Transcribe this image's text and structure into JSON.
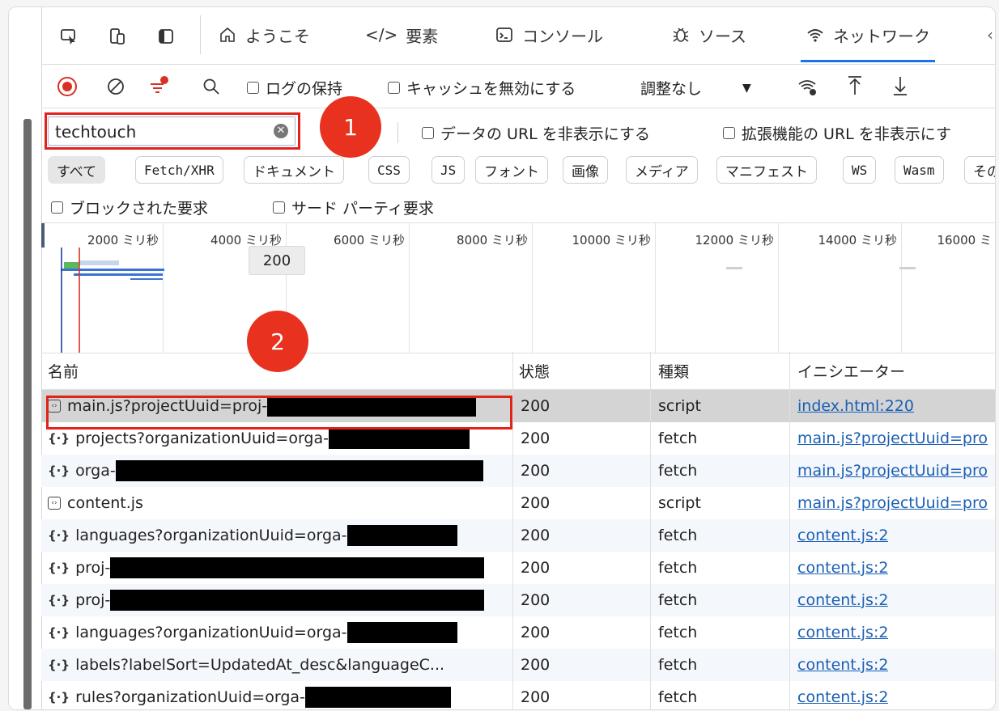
{
  "toolbar": {
    "tabs": [
      {
        "label": "ようこそ",
        "icon": "home-icon"
      },
      {
        "label": "要素",
        "icon": "code-tag-icon"
      },
      {
        "label": "コンソール",
        "icon": "console-icon"
      },
      {
        "label": "ソース",
        "icon": "bug-icon"
      },
      {
        "label": "ネットワーク",
        "icon": "wifi-icon",
        "active": true
      }
    ],
    "icons": [
      "inspect-icon",
      "device-emulation-icon",
      "dock-icon"
    ]
  },
  "network_controls": {
    "preserve_log_label": "ログの保持",
    "disable_cache_label": "キャッシュを無効にする",
    "throttling_value": "調整なし"
  },
  "filter": {
    "search_value": "techtouch",
    "hide_data_urls_label": "データの URL を非表示にする",
    "hide_extension_urls_label": "拡張機能の URL を非表示にす",
    "types": [
      "すべて",
      "Fetch/XHR",
      "ドキュメント",
      "CSS",
      "JS",
      "フォント",
      "画像",
      "メディア",
      "マニフェスト",
      "WS",
      "Wasm",
      "その"
    ],
    "blocked_requests_label": "ブロックされた要求",
    "third_party_label": "サード パーティ要求"
  },
  "overview": {
    "ticks": [
      "2000 ミリ秒",
      "4000 ミリ秒",
      "6000 ミリ秒",
      "8000 ミリ秒",
      "10000 ミリ秒",
      "12000 ミリ秒",
      "14000 ミリ秒",
      "16000 ミ"
    ],
    "tooltip": "200"
  },
  "annotations": {
    "badge1": "1",
    "badge2": "2"
  },
  "table": {
    "headers": {
      "name": "名前",
      "status": "状態",
      "type": "種類",
      "initiator": "イニシエーター"
    },
    "rows": [
      {
        "name": "main.js?projectUuid=proj-",
        "status": "200",
        "type": "script",
        "initiator": "index.html:220"
      },
      {
        "name": "projects?organizationUuid=orga-",
        "status": "200",
        "type": "fetch",
        "initiator": "main.js?projectUuid=pro"
      },
      {
        "name": "orga-",
        "status": "200",
        "type": "fetch",
        "initiator": "main.js?projectUuid=pro"
      },
      {
        "name": "content.js",
        "status": "200",
        "type": "script",
        "initiator": "main.js?projectUuid=pro"
      },
      {
        "name": "languages?organizationUuid=orga-",
        "status": "200",
        "type": "fetch",
        "initiator": "content.js:2"
      },
      {
        "name": "proj-",
        "status": "200",
        "type": "fetch",
        "initiator": "content.js:2"
      },
      {
        "name": "proj-",
        "status": "200",
        "type": "fetch",
        "initiator": "content.js:2"
      },
      {
        "name": "languages?organizationUuid=orga-",
        "status": "200",
        "type": "fetch",
        "initiator": "content.js:2"
      },
      {
        "name": "labels?labelSort=UpdatedAt_desc&languageC...",
        "status": "200",
        "type": "fetch",
        "initiator": "content.js:2"
      },
      {
        "name": "rules?organizationUuid=orga-",
        "status": "200",
        "type": "fetch",
        "initiator": "content.js:2"
      }
    ]
  },
  "colors": {
    "accent": "#1a73e8",
    "highlight": "#e2231a",
    "badge": "#e8311e",
    "record": "#d93025"
  }
}
